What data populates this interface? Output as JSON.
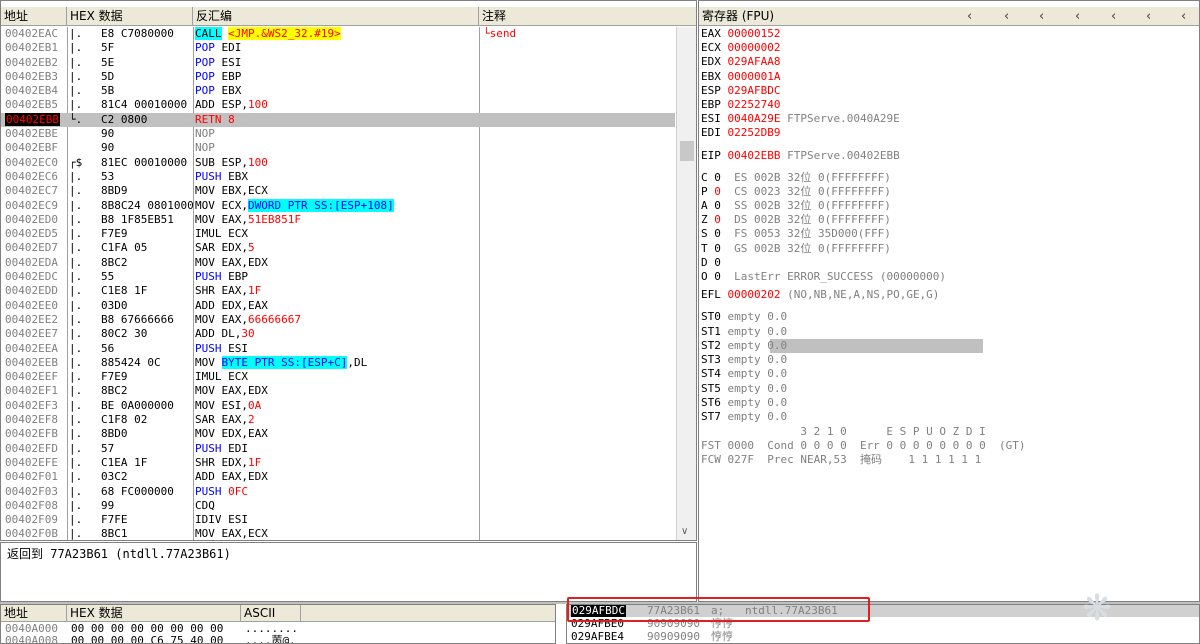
{
  "cpu": {
    "headers": {
      "addr": "地址",
      "hex": "HEX 数据",
      "disasm": "反汇编",
      "comment": "注释"
    },
    "rows": [
      {
        "addr": "00402EAC",
        "mark": "|.",
        "hex": "E8 C7080000",
        "ins": "CALL <JMP.&WS2_32.#19>",
        "cmt": "└send",
        "kind": "call"
      },
      {
        "addr": "00402EB1",
        "mark": "|.",
        "hex": "5F",
        "ins": "POP EDI",
        "cmt": "",
        "kind": "pop"
      },
      {
        "addr": "00402EB2",
        "mark": "|.",
        "hex": "5E",
        "ins": "POP ESI",
        "cmt": "",
        "kind": "pop"
      },
      {
        "addr": "00402EB3",
        "mark": "|.",
        "hex": "5D",
        "ins": "POP EBP",
        "cmt": "",
        "kind": "pop"
      },
      {
        "addr": "00402EB4",
        "mark": "|.",
        "hex": "5B",
        "ins": "POP EBX",
        "cmt": "",
        "kind": "pop"
      },
      {
        "addr": "00402EB5",
        "mark": "|.",
        "hex": "81C4 00010000",
        "ins": "ADD ESP,100",
        "cmt": "",
        "kind": "plain"
      },
      {
        "addr": "00402EBB",
        "mark": "└.",
        "hex": "C2 0800",
        "ins": "RETN 8",
        "cmt": "",
        "kind": "ret",
        "selected": true
      },
      {
        "addr": "00402EBE",
        "mark": "",
        "hex": "90",
        "ins": "NOP",
        "cmt": "",
        "kind": "gray"
      },
      {
        "addr": "00402EBF",
        "mark": "",
        "hex": "90",
        "ins": "NOP",
        "cmt": "",
        "kind": "gray"
      },
      {
        "addr": "00402EC0",
        "mark": "┌$",
        "hex": "81EC 00010000",
        "ins": "SUB ESP,100",
        "cmt": "",
        "kind": "plain"
      },
      {
        "addr": "00402EC6",
        "mark": "|.",
        "hex": "53",
        "ins": "PUSH EBX",
        "cmt": "",
        "kind": "push"
      },
      {
        "addr": "00402EC7",
        "mark": "|.",
        "hex": "8BD9",
        "ins": "MOV EBX,ECX",
        "cmt": "",
        "kind": "plain"
      },
      {
        "addr": "00402EC9",
        "mark": "|.",
        "hex": "8B8C24 08010000",
        "ins": "MOV ECX,DWORD PTR SS:[ESP+108]",
        "cmt": "",
        "kind": "mem"
      },
      {
        "addr": "00402ED0",
        "mark": "|.",
        "hex": "B8 1F85EB51",
        "ins": "MOV EAX,51EB851F",
        "cmt": "",
        "kind": "plain"
      },
      {
        "addr": "00402ED5",
        "mark": "|.",
        "hex": "F7E9",
        "ins": "IMUL ECX",
        "cmt": "",
        "kind": "plain"
      },
      {
        "addr": "00402ED7",
        "mark": "|.",
        "hex": "C1FA 05",
        "ins": "SAR EDX,5",
        "cmt": "",
        "kind": "plain"
      },
      {
        "addr": "00402EDA",
        "mark": "|.",
        "hex": "8BC2",
        "ins": "MOV EAX,EDX",
        "cmt": "",
        "kind": "plain"
      },
      {
        "addr": "00402EDC",
        "mark": "|.",
        "hex": "55",
        "ins": "PUSH EBP",
        "cmt": "",
        "kind": "push"
      },
      {
        "addr": "00402EDD",
        "mark": "|.",
        "hex": "C1E8 1F",
        "ins": "SHR EAX,1F",
        "cmt": "",
        "kind": "plain"
      },
      {
        "addr": "00402EE0",
        "mark": "|.",
        "hex": "03D0",
        "ins": "ADD EDX,EAX",
        "cmt": "",
        "kind": "plain"
      },
      {
        "addr": "00402EE2",
        "mark": "|.",
        "hex": "B8 67666666",
        "ins": "MOV EAX,66666667",
        "cmt": "",
        "kind": "plain"
      },
      {
        "addr": "00402EE7",
        "mark": "|.",
        "hex": "80C2 30",
        "ins": "ADD DL,30",
        "cmt": "",
        "kind": "plain"
      },
      {
        "addr": "00402EEA",
        "mark": "|.",
        "hex": "56",
        "ins": "PUSH ESI",
        "cmt": "",
        "kind": "push"
      },
      {
        "addr": "00402EEB",
        "mark": "|.",
        "hex": "885424 0C",
        "ins": "MOV BYTE PTR SS:[ESP+C],DL",
        "cmt": "",
        "kind": "mem"
      },
      {
        "addr": "00402EEF",
        "mark": "|.",
        "hex": "F7E9",
        "ins": "IMUL ECX",
        "cmt": "",
        "kind": "plain"
      },
      {
        "addr": "00402EF1",
        "mark": "|.",
        "hex": "8BC2",
        "ins": "MOV EAX,EDX",
        "cmt": "",
        "kind": "plain"
      },
      {
        "addr": "00402EF3",
        "mark": "|.",
        "hex": "BE 0A000000",
        "ins": "MOV ESI,0A",
        "cmt": "",
        "kind": "plain"
      },
      {
        "addr": "00402EF8",
        "mark": "|.",
        "hex": "C1F8 02",
        "ins": "SAR EAX,2",
        "cmt": "",
        "kind": "plain"
      },
      {
        "addr": "00402EFB",
        "mark": "|.",
        "hex": "8BD0",
        "ins": "MOV EDX,EAX",
        "cmt": "",
        "kind": "plain"
      },
      {
        "addr": "00402EFD",
        "mark": "|.",
        "hex": "57",
        "ins": "PUSH EDI",
        "cmt": "",
        "kind": "push"
      },
      {
        "addr": "00402EFE",
        "mark": "|.",
        "hex": "C1EA 1F",
        "ins": "SHR EDX,1F",
        "cmt": "",
        "kind": "plain"
      },
      {
        "addr": "00402F01",
        "mark": "|.",
        "hex": "03C2",
        "ins": "ADD EAX,EDX",
        "cmt": "",
        "kind": "plain"
      },
      {
        "addr": "00402F03",
        "mark": "|.",
        "hex": "68 FC000000",
        "ins": "PUSH 0FC",
        "cmt": "",
        "kind": "push"
      },
      {
        "addr": "00402F08",
        "mark": "|.",
        "hex": "99",
        "ins": "CDQ",
        "cmt": "",
        "kind": "plain"
      },
      {
        "addr": "00402F09",
        "mark": "|.",
        "hex": "F7FE",
        "ins": "IDIV ESI",
        "cmt": "",
        "kind": "plain"
      },
      {
        "addr": "00402F0B",
        "mark": "|.",
        "hex": "8BC1",
        "ins": "MOV EAX,ECX",
        "cmt": "",
        "kind": "plain"
      }
    ]
  },
  "info": {
    "text": "返回到 77A23B61 (ntdll.77A23B61)"
  },
  "registers": {
    "title": "寄存器 (FPU)",
    "gp": [
      {
        "name": "EAX",
        "value": "00000152",
        "extra": ""
      },
      {
        "name": "ECX",
        "value": "00000002",
        "extra": ""
      },
      {
        "name": "EDX",
        "value": "029AFAA8",
        "extra": ""
      },
      {
        "name": "EBX",
        "value": "0000001A",
        "extra": ""
      },
      {
        "name": "ESP",
        "value": "029AFBDC",
        "extra": ""
      },
      {
        "name": "EBP",
        "value": "02252740",
        "extra": ""
      },
      {
        "name": "ESI",
        "value": "0040A29E",
        "extra": "FTPServe.0040A29E"
      },
      {
        "name": "EDI",
        "value": "02252DB9",
        "extra": ""
      }
    ],
    "eip": {
      "name": "EIP",
      "value": "00402EBB",
      "extra": "FTPServe.00402EBB"
    },
    "flags": [
      {
        "flag": "C",
        "bit": "0",
        "bit_red": false,
        "seg": "ES 002B 32位 0(FFFFFFFF)"
      },
      {
        "flag": "P",
        "bit": "0",
        "bit_red": true,
        "seg": "CS 0023 32位 0(FFFFFFFF)"
      },
      {
        "flag": "A",
        "bit": "0",
        "bit_red": false,
        "seg": "SS 002B 32位 0(FFFFFFFF)"
      },
      {
        "flag": "Z",
        "bit": "0",
        "bit_red": true,
        "seg": "DS 002B 32位 0(FFFFFFFF)"
      },
      {
        "flag": "S",
        "bit": "0",
        "bit_red": false,
        "seg": "FS 0053 32位 35D000(FFF)"
      },
      {
        "flag": "T",
        "bit": "0",
        "bit_red": false,
        "seg": "GS 002B 32位 0(FFFFFFFF)"
      },
      {
        "flag": "D",
        "bit": "0",
        "bit_red": false,
        "seg": ""
      },
      {
        "flag": "O",
        "bit": "0",
        "bit_red": false,
        "seg": "LastErr ERROR_SUCCESS (00000000)"
      }
    ],
    "efl": {
      "name": "EFL",
      "value": "00000202",
      "extra": "(NO,NB,NE,A,NS,PO,GE,G)"
    },
    "fpu": [
      {
        "name": "ST0",
        "text": "empty 0.0"
      },
      {
        "name": "ST1",
        "text": "empty 0.0"
      },
      {
        "name": "ST2",
        "text": "empty 0.0"
      },
      {
        "name": "ST3",
        "text": "empty 0.0"
      },
      {
        "name": "ST4",
        "text": "empty 0.0"
      },
      {
        "name": "ST5",
        "text": "empty 0.0"
      },
      {
        "name": "ST6",
        "text": "empty 0.0"
      },
      {
        "name": "ST7",
        "text": "empty 0.0"
      }
    ],
    "fpu_bits_header": "               3 2 1 0      E S P U O Z D I",
    "fst_line": "FST 0000  Cond 0 0 0 0  Err 0 0 0 0 0 0 0 0  (GT)",
    "fcw_line": "FCW 027F  Prec NEAR,53  掩码    1 1 1 1 1 1"
  },
  "dump": {
    "headers": {
      "addr": "地址",
      "hex": "HEX 数据",
      "ascii": "ASCII"
    },
    "rows": [
      {
        "addr": "0040A000",
        "hex": "00 00 00 00 00 00 00 00",
        "ascii": "........"
      },
      {
        "addr": "0040A008",
        "hex": "00 00 00 00 C6 75 40 00",
        "ascii": "....苪@."
      }
    ]
  },
  "stack": {
    "rows": [
      {
        "addr": "029AFBDC",
        "val": "77A23B61",
        "asc": "a;",
        "cmt": "ntdll.77A23B61",
        "selected": true
      },
      {
        "addr": "029AFBE0",
        "val": "90909090",
        "asc": "悙悙",
        "cmt": "",
        "selected": false
      },
      {
        "addr": "029AFBE4",
        "val": "90909090",
        "asc": "悙悙",
        "cmt": "",
        "selected": false
      }
    ]
  },
  "colors": {
    "red": "#ff0000",
    "blue": "#0000ff",
    "cyan": "#00ffff",
    "yellow": "#ffff00",
    "gray": "#808080",
    "highlight_box": "#e02020"
  }
}
